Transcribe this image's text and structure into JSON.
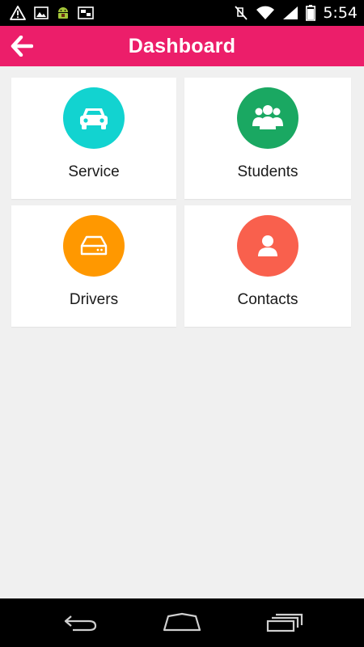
{
  "status_bar": {
    "time": "5:54",
    "left_icons": [
      "warning-icon",
      "image-icon",
      "android-debug-icon",
      "screenshot-icon"
    ],
    "right_icons": [
      "mute-icon",
      "wifi-icon",
      "signal-icon",
      "battery-icon"
    ]
  },
  "app_bar": {
    "title": "Dashboard",
    "back_icon": "arrow-left-icon",
    "color": "#ec1e6a"
  },
  "tiles": [
    {
      "label": "Service",
      "icon": "car-icon",
      "color": "#12d3d0"
    },
    {
      "label": "Students",
      "icon": "group-icon",
      "color": "#1aa862"
    },
    {
      "label": "Drivers",
      "icon": "hard-drive-icon",
      "color": "#ff9800"
    },
    {
      "label": "Contacts",
      "icon": "person-icon",
      "color": "#f9604d"
    }
  ],
  "nav_bar": {
    "buttons": [
      "back-icon",
      "home-icon",
      "recents-icon"
    ]
  }
}
